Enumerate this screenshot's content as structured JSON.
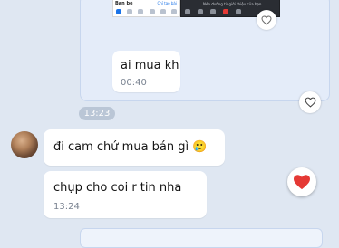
{
  "shared_preview": {
    "left_thumb_title": "Bạn bè",
    "left_thumb_right": "Chỉ tạo bài",
    "right_thumb_text": "Nén đường từ giới thiệu của bạn"
  },
  "messages": [
    {
      "text": "ai mua kh",
      "time": "00:40",
      "outgoing": true
    },
    {
      "text": "đi cam chứ mua bán gì 🥲",
      "outgoing": false
    },
    {
      "text": "chụp cho coi r tin nha",
      "time": "13:24",
      "outgoing": false,
      "reaction": "heart"
    }
  ],
  "date_divider": "13:23",
  "colors": {
    "heart": "#e53935",
    "background": "#dfe7f2",
    "bubble": "#ffffff"
  }
}
